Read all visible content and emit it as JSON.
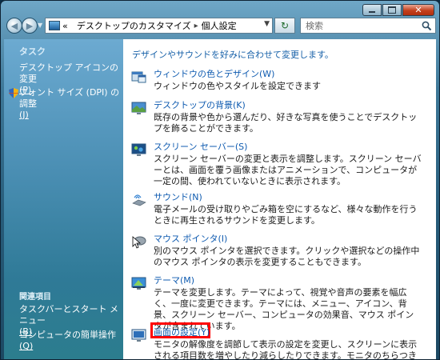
{
  "window": {
    "caption_buttons": [
      "minimize",
      "maximize",
      "close"
    ]
  },
  "nav": {
    "address_crumbs": [
      "«",
      "デスクトップのカスタマイズ",
      "個人設定"
    ],
    "search_placeholder": "検索"
  },
  "sidebar": {
    "tasks_heading": "タスク",
    "tasks": [
      {
        "label": "デスクトップ アイコンの変更",
        "accel": "(P)"
      },
      {
        "label": "フォント サイズ (DPI) の調整",
        "accel": "(J)"
      }
    ],
    "related_heading": "関連項目",
    "related": [
      {
        "label": "タスクバーとスタート メニュー",
        "accel": "(B)"
      },
      {
        "label": "コンピュータの簡単操作",
        "accel": "(Q)"
      }
    ]
  },
  "main": {
    "intro": "デザインやサウンドを好みに合わせて変更します。",
    "items": [
      {
        "title": "ウィンドウの色とデザイン(W)",
        "desc": "ウィンドウの色やスタイルを設定できます"
      },
      {
        "title": "デスクトップの背景(K)",
        "desc": "既存の背景や色から選んだり、好きな写真を使うことでデスクトップを飾ることができます。"
      },
      {
        "title": "スクリーン セーバー(S)",
        "desc": "スクリーン セーバーの変更と表示を調整します。スクリーン セーバーとは、画面を覆う画像またはアニメーションで、コンピュータが一定の間、使われていないときに表示されます。"
      },
      {
        "title": "サウンド(N)",
        "desc": "電子メールの受け取りやごみ箱を空にするなど、様々な動作を行うときに再生されるサウンドを変更します。"
      },
      {
        "title": "マウス ポインタ(I)",
        "desc": "別のマウス ポインタを選択できます。クリックや選択などの操作中のマウス ポインタの表示を変更することもできます。"
      },
      {
        "title": "テーマ(M)",
        "desc": "テーマを変更します。テーマによって、視覚や音声の要素を幅広く、一度に変更できます。テーマには、メニュー、アイコン、背景、スクリーン セーバー、コンピュータの効果音、マウス ポインタが含まれています。"
      },
      {
        "title": "画面の設定(Y)",
        "desc": "モニタの解像度を調節して表示の設定を変更し、スクリーンに表示される項目数を増やしたり減らしたりできます。モニタのちらつきを抑えることもできます (リフレッシュ"
      }
    ]
  },
  "colors": {
    "link": "#0f5bb0",
    "highlight_border": "#ff0000",
    "sidebar_top": "#6caad1"
  }
}
